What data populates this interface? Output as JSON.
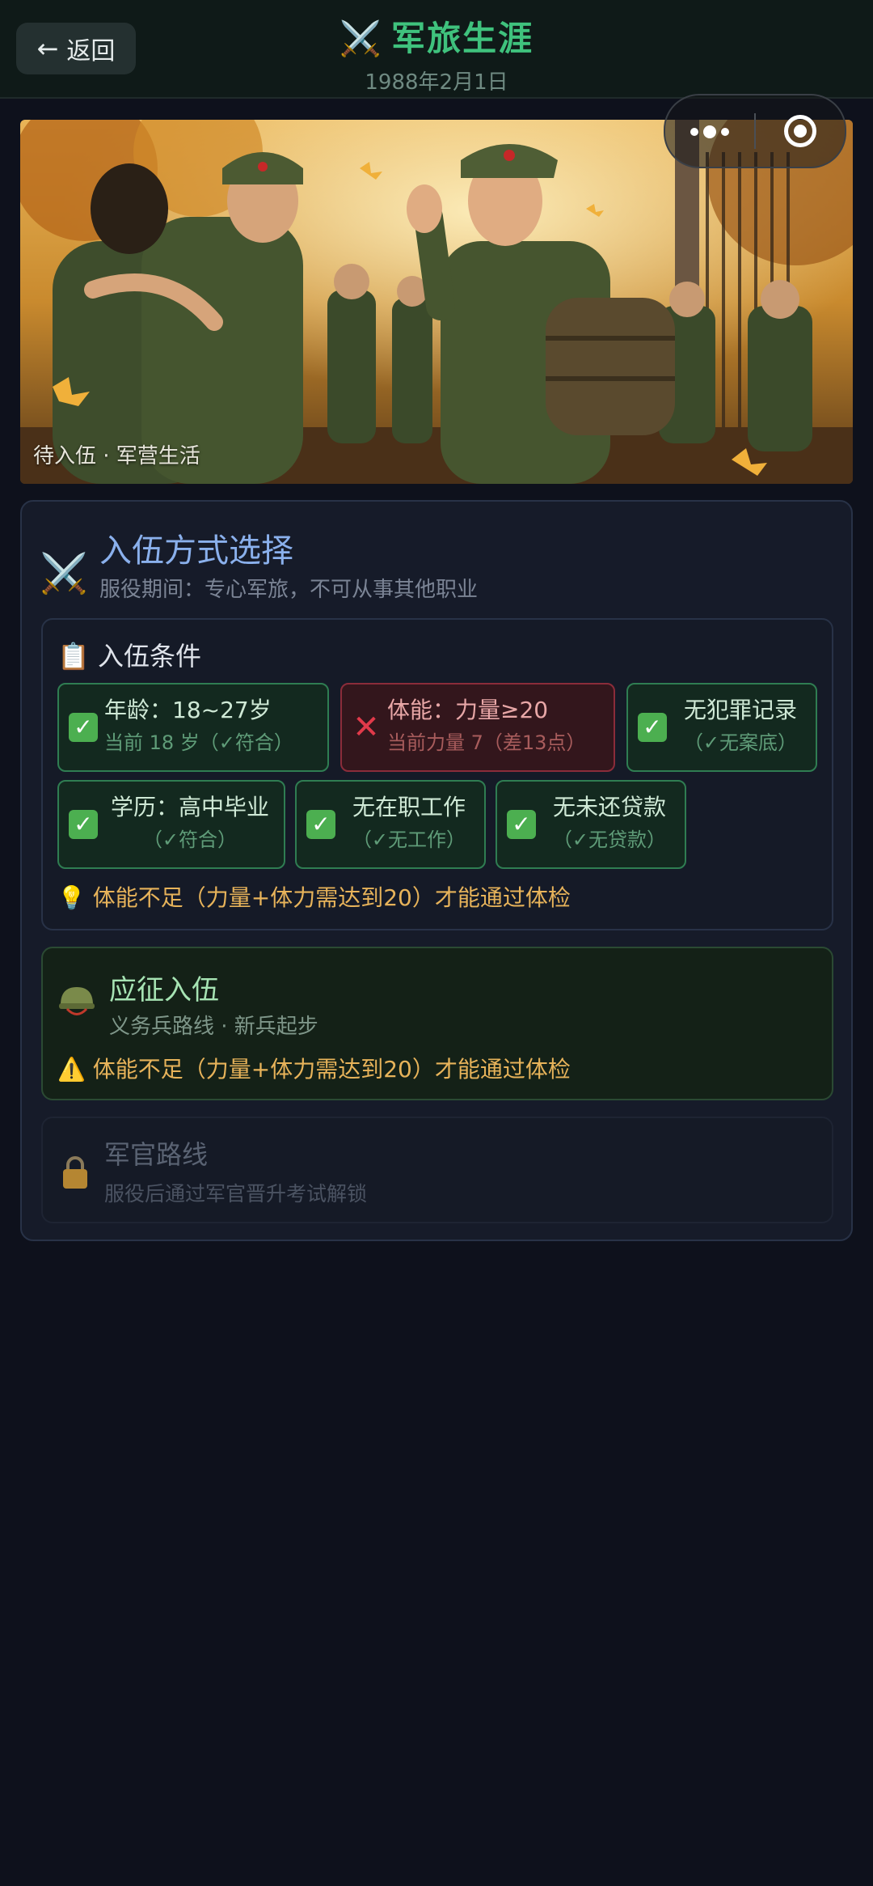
{
  "header": {
    "back_label": "返回",
    "title_icon": "⚔️",
    "title": "军旅生涯",
    "date": "1988年2月1日"
  },
  "banner": {
    "caption": "待入伍 · 军营生活"
  },
  "section": {
    "icon": "⚔️",
    "title": "入伍方式选择",
    "subtitle": "服役期间：专心军旅，不可从事其他职业"
  },
  "conditions": {
    "title": "📋 入伍条件",
    "items": [
      {
        "label": "年龄：18~27岁",
        "detail": "当前 18 岁（✓符合）",
        "status": "pass"
      },
      {
        "label": "体能：力量≥20",
        "detail": "当前力量 7（差13点）",
        "status": "fail"
      },
      {
        "label": "无犯罪记录",
        "detail": "（✓无案底）",
        "status": "pass"
      },
      {
        "label": "学历：高中毕业",
        "detail": "（✓符合）",
        "status": "pass"
      },
      {
        "label": "无在职工作",
        "detail": "（✓无工作）",
        "status": "pass"
      },
      {
        "label": "无未还贷款",
        "detail": "（✓无贷款）",
        "status": "pass"
      }
    ],
    "tip": "💡 体能不足（力量+体力需达到20）才能通过体检"
  },
  "enlist": {
    "title": "应征入伍",
    "subtitle": "义务兵路线 · 新兵起步",
    "warning": "⚠️ 体能不足（力量+体力需达到20）才能通过体检"
  },
  "officer": {
    "title": "军官路线",
    "subtitle": "服役后通过军官晋升考试解锁"
  },
  "colors": {
    "accent_green": "#3fc27d",
    "title_blue": "#8ab0ec",
    "warning_amber": "#e7b35a",
    "fail_red": "#e23a4a"
  }
}
